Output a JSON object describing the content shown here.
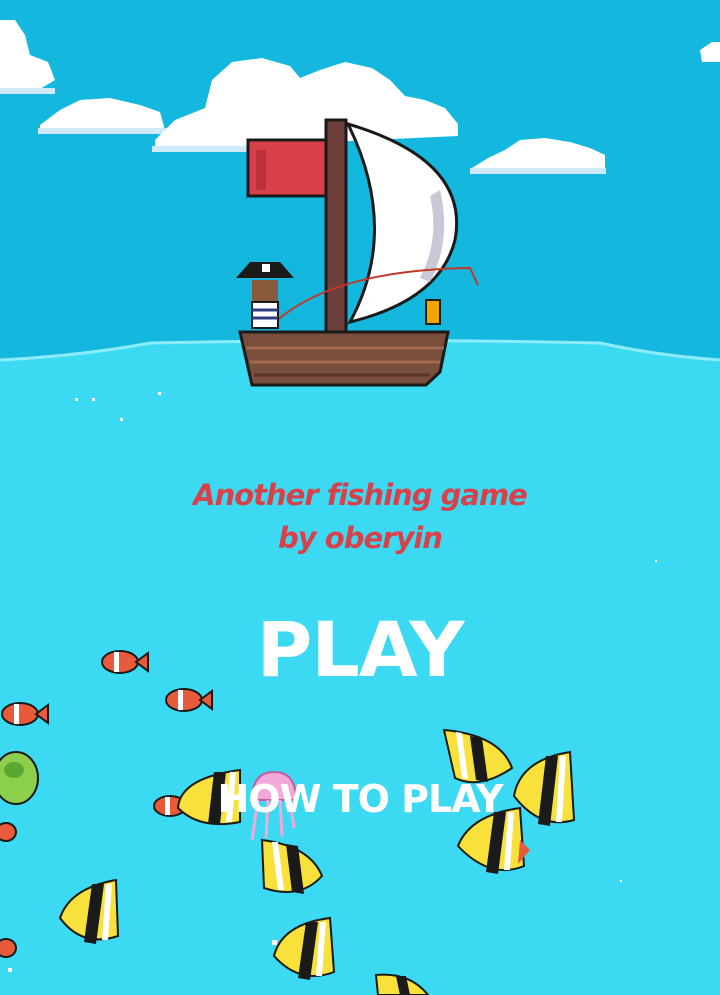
{
  "title_lines": [
    "Another fishing game",
    "by oberyin"
  ],
  "menu": {
    "play": "PLAY",
    "how_to_play": "HOW TO PLAY"
  },
  "colors": {
    "sky": "#14b8de",
    "sea": "#3bd9f2",
    "title_text": "#d8414a",
    "menu_text": "#ffffff"
  },
  "icons": [
    "cloud-icon",
    "sailboat-icon",
    "pirate-icon",
    "clownfish-icon",
    "angelfish-icon",
    "jellyfish-icon",
    "turtle-icon"
  ]
}
